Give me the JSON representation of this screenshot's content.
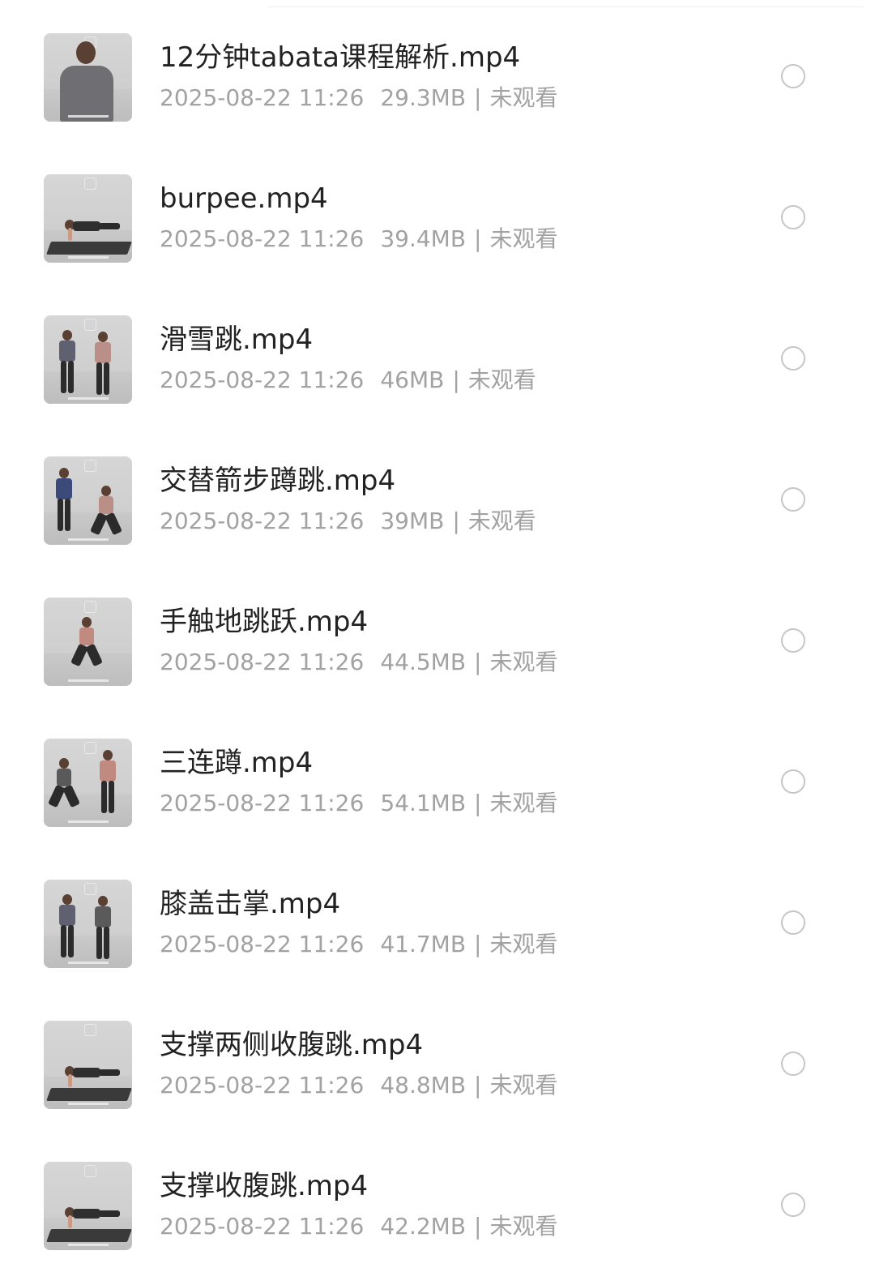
{
  "files": [
    {
      "name": "12分钟tabata课程解析.mp4",
      "date": "2025-08-22 11:26",
      "size": "29.3MB",
      "status": "未观看",
      "thumb": "trainer-talking"
    },
    {
      "name": "burpee.mp4",
      "date": "2025-08-22 11:26",
      "size": "39.4MB",
      "status": "未观看",
      "thumb": "plank-on-mat"
    },
    {
      "name": "滑雪跳.mp4",
      "date": "2025-08-22 11:26",
      "size": "46MB",
      "status": "未观看",
      "thumb": "two-standing"
    },
    {
      "name": "交替箭步蹲跳.mp4",
      "date": "2025-08-22 11:26",
      "size": "39MB",
      "status": "未观看",
      "thumb": "lunge-pair"
    },
    {
      "name": "手触地跳跃.mp4",
      "date": "2025-08-22 11:26",
      "size": "44.5MB",
      "status": "未观看",
      "thumb": "squat-touch"
    },
    {
      "name": "三连蹲.mp4",
      "date": "2025-08-22 11:26",
      "size": "54.1MB",
      "status": "未观看",
      "thumb": "squat-pair"
    },
    {
      "name": "膝盖击掌.mp4",
      "date": "2025-08-22 11:26",
      "size": "41.7MB",
      "status": "未观看",
      "thumb": "two-men-standing"
    },
    {
      "name": "支撑两侧收腹跳.mp4",
      "date": "2025-08-22 11:26",
      "size": "48.8MB",
      "status": "未观看",
      "thumb": "plank-on-mat"
    },
    {
      "name": "支撑收腹跳.mp4",
      "date": "2025-08-22 11:26",
      "size": "42.2MB",
      "status": "未观看",
      "thumb": "plank-on-mat"
    }
  ],
  "meta_separator": "|",
  "colors": {
    "title_text": "#222222",
    "meta_text": "#a2a2a2",
    "radio_border": "#c6c6c6",
    "background": "#ffffff"
  }
}
